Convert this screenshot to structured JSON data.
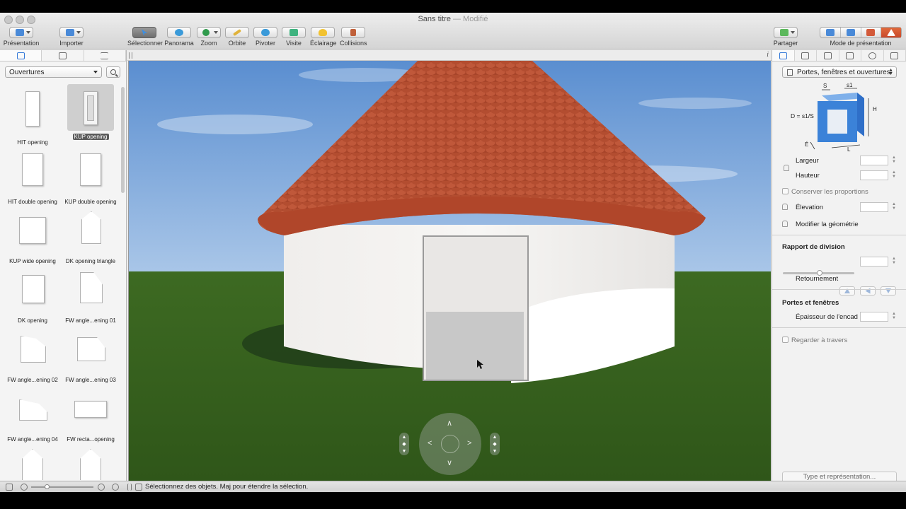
{
  "window": {
    "title": "Sans titre",
    "title_suffix": "— Modifié"
  },
  "toolbar": {
    "presentation": "Présentation",
    "importer": "Importer",
    "selectionner": "Sélectionner",
    "panorama": "Panorama",
    "zoom": "Zoom",
    "orbite": "Orbite",
    "pivoter": "Pivoter",
    "visite": "Visite",
    "eclairage": "Éclairage",
    "collisions": "Collisions",
    "partager": "Partager",
    "mode_presentation": "Mode de présentation"
  },
  "library": {
    "category": "Ouvertures",
    "items": [
      {
        "label": "HIT opening",
        "icon": "door-opening-icon"
      },
      {
        "label": "KUP opening",
        "icon": "door-opening-icon"
      },
      {
        "label": "HIT double opening",
        "icon": "double-opening-icon"
      },
      {
        "label": "KUP double opening",
        "icon": "double-opening-icon"
      },
      {
        "label": "KUP wide opening",
        "icon": "wide-opening-icon"
      },
      {
        "label": "DK opening triangle",
        "icon": "triangle-opening-icon"
      },
      {
        "label": "DK opening",
        "icon": "opening-icon"
      },
      {
        "label": "FW angle...ening 01",
        "icon": "angled-opening-icon"
      },
      {
        "label": "FW angle...ening 02",
        "icon": "angled-opening-icon"
      },
      {
        "label": "FW angle...ening 03",
        "icon": "angled-opening-icon"
      },
      {
        "label": "FW angle...ening 04",
        "icon": "angled-opening-icon"
      },
      {
        "label": "FW recta...opening",
        "icon": "rectangular-opening-icon"
      }
    ],
    "selected": "KUP opening"
  },
  "inspector": {
    "type_select": "Portes, fenêtres et ouvertures",
    "diagram": {
      "formula": "D = s1/S",
      "s": "S",
      "s1": "s1",
      "h": "H",
      "e": "É",
      "l": "L"
    },
    "largeur": "Largeur",
    "hauteur": "Hauteur",
    "conserver": "Conserver les proportions",
    "elevation": "Élevation",
    "modifier": "Modifier la géométrie",
    "rapport_title": "Rapport de division",
    "retournement": "Retournement",
    "portes_title": "Portes et fenêtres",
    "epaisseur": "Épaisseur de l'encadrement",
    "regarder": "Regarder à travers",
    "type_button": "Type et représentation..."
  },
  "status": {
    "message": "Sélectionnez des objets. Maj pour étendre la sélection."
  },
  "colors": {
    "accent": "#3478d8",
    "roof": "#b5502f",
    "grass": "#3f6b22",
    "sky": "#6e9fd6"
  }
}
